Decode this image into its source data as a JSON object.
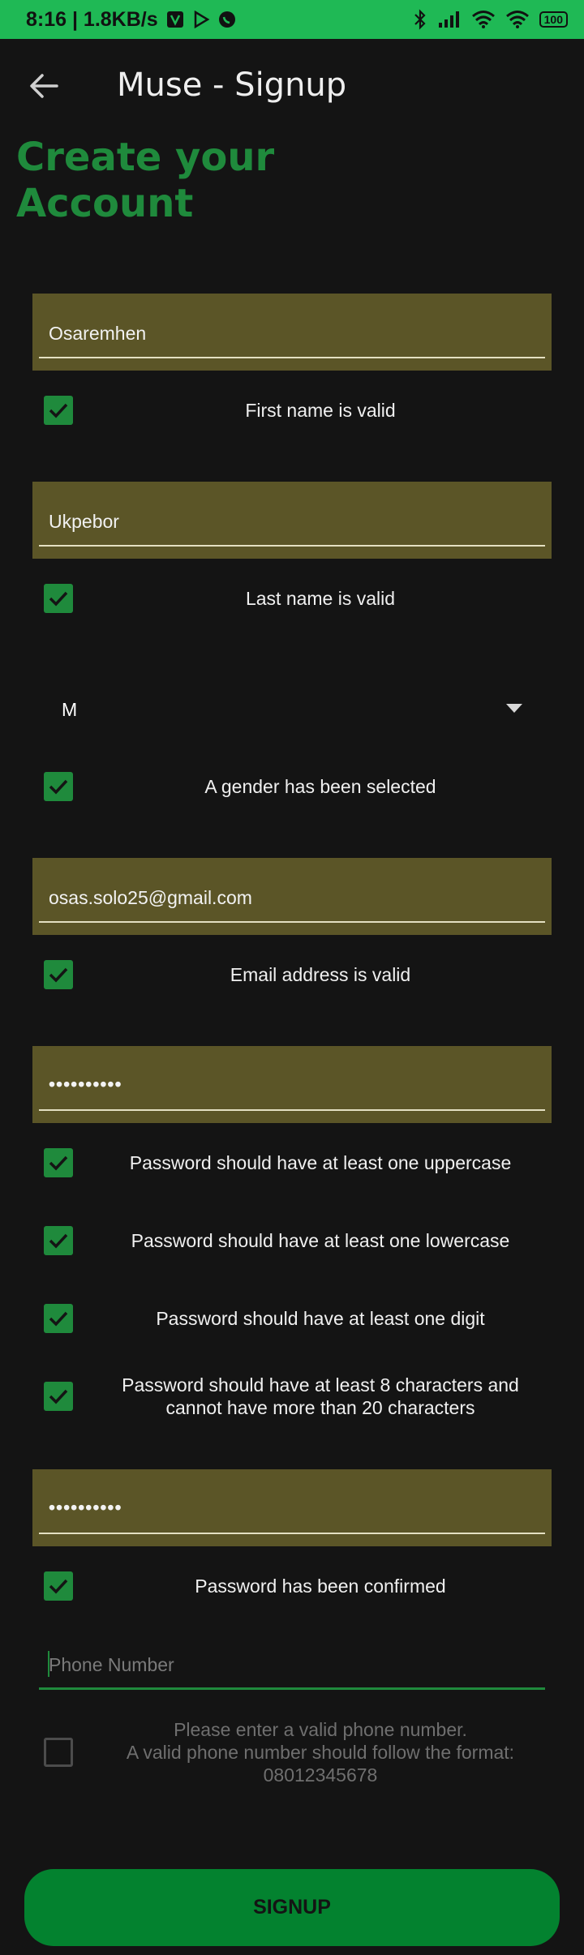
{
  "status_bar": {
    "time_speed": "8:16 | 1.8KB/s",
    "battery": "100"
  },
  "app_bar": {
    "title": "Muse - Signup"
  },
  "heading": "Create your Account",
  "form": {
    "first_name": {
      "value": "Osaremhen",
      "check": "First name is valid"
    },
    "last_name": {
      "value": "Ukpebor",
      "check": "Last name is valid"
    },
    "gender": {
      "selected": "M",
      "check": "A gender has been selected"
    },
    "email": {
      "value": "osas.solo25@gmail.com",
      "check": "Email address is valid"
    },
    "password": {
      "value": "••••••••••",
      "checks": {
        "uppercase": "Password should have at least one uppercase",
        "lowercase": "Password should have at least one lowercase",
        "digit": "Password should have at least one digit",
        "length_line1": "Password should have at least 8 characters and",
        "length_line2": "cannot have more than 20 characters"
      }
    },
    "confirm_password": {
      "value": "••••••••••",
      "check": "Password has been confirmed"
    },
    "phone": {
      "placeholder": "Phone Number",
      "hint_line1": "Please enter a valid phone number.",
      "hint_line2": "A valid phone number should follow the format:",
      "hint_line3": "08012345678"
    }
  },
  "signup_label": "SIGNUP",
  "colors": {
    "status_bar": "#1fb955",
    "accent_green": "#1f8a3c",
    "field_bg": "#5b5527",
    "background": "#141414",
    "button": "#03822f"
  }
}
